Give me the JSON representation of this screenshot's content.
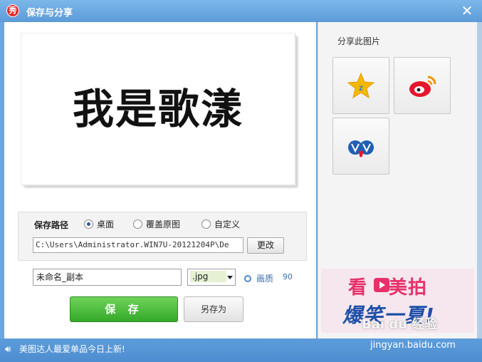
{
  "window": {
    "title": "保存与分享",
    "logo_text": "秀",
    "close": "✕"
  },
  "preview": {
    "text": "我是歌漾"
  },
  "save_path": {
    "label": "保存路径",
    "options": [
      {
        "label": "桌面",
        "selected": true
      },
      {
        "label": "覆盖原图",
        "selected": false
      },
      {
        "label": "自定义",
        "selected": false
      }
    ],
    "path_value": "C:\\Users\\Administrator.WIN7U-20121204P\\De",
    "change_label": "更改"
  },
  "file": {
    "name_value": "未命名_副本",
    "format_value": ".jpg",
    "quality_label": "画质",
    "quality_value": "90"
  },
  "actions": {
    "save_label": "保 存",
    "save_as_label": "另存为"
  },
  "share": {
    "title": "分享此图片",
    "targets": [
      {
        "icon": "qzone-icon"
      },
      {
        "icon": "weibo-icon"
      },
      {
        "icon": "renren-icon"
      }
    ]
  },
  "ad": {
    "line1_a": "看",
    "line1_b": "美拍",
    "line2": "爆笑一夏!"
  },
  "status": {
    "text": "美图达人最爱单品今日上新!"
  },
  "watermark": {
    "logo": "Bai du 经验",
    "url": "jingyan.baidu.com"
  },
  "colors": {
    "title_bar": "#5b9bd8",
    "save_green": "#34a92a",
    "accent_blue": "#3b6fb0"
  }
}
